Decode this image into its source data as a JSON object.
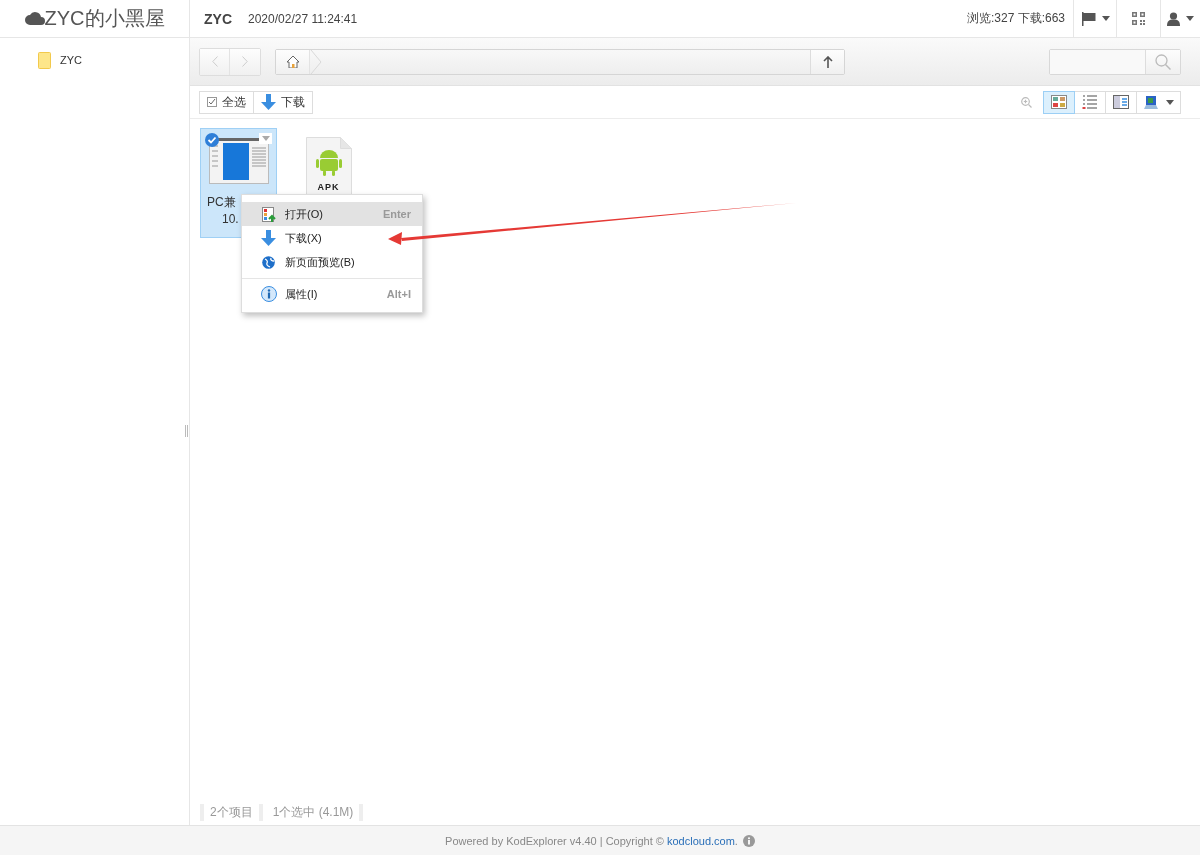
{
  "header": {
    "site_title": "ZYC的小黑屋",
    "user": "ZYC",
    "datetime": "2020/02/27 11:24:41",
    "stats": "浏览:327 下载:663"
  },
  "sidebar": {
    "tree": [
      {
        "label": "ZYC"
      }
    ]
  },
  "toolbar": {
    "buttons": [
      {
        "kind": "select-all",
        "label": "全选"
      },
      {
        "kind": "download",
        "label": "下载"
      }
    ],
    "views": [
      {
        "kind": "icons",
        "selected": true
      },
      {
        "kind": "list",
        "selected": false
      },
      {
        "kind": "split",
        "selected": false
      }
    ]
  },
  "files": [
    {
      "kind": "exe",
      "lines": [
        "PC兼",
        "10."
      ],
      "selected": true
    },
    {
      "kind": "apk",
      "icon_text": "APK",
      "selected": false
    }
  ],
  "context_menu": {
    "items": [
      {
        "kind": "item",
        "label": "打开(O)",
        "shortcut": "Enter",
        "highlighted": true
      },
      {
        "kind": "item",
        "label": "下载(X)",
        "highlighted": false
      },
      {
        "kind": "item",
        "label": "新页面预览(B)",
        "highlighted": false
      },
      {
        "kind": "divider"
      },
      {
        "kind": "item",
        "label": "属性(I)",
        "shortcut": "Alt+I",
        "highlighted": false
      }
    ]
  },
  "status_bar": {
    "items": [
      "2个项目",
      "1个选中 (4.1M)"
    ]
  },
  "footer": {
    "text": "Powered by KodExplorer v4.40 | Copyright ©",
    "link": "kodcloud.com",
    "after": "."
  }
}
